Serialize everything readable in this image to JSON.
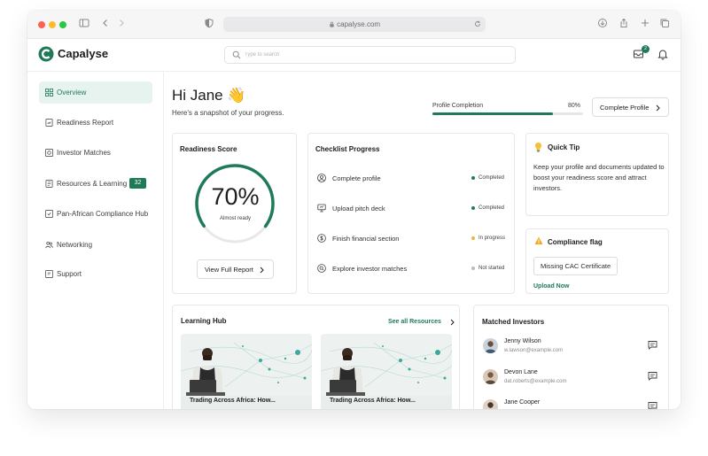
{
  "browser": {
    "url": "capalyse.com",
    "dot_colors": [
      "#fe5f57",
      "#febc2e",
      "#28c840"
    ]
  },
  "header": {
    "logo_text": "Capalyse",
    "search_placeholder": "Type to search",
    "notification_count": "2",
    "brand_color": "#1e7a57"
  },
  "sidebar": {
    "items": [
      {
        "label": "Overview",
        "icon": "grid-icon",
        "active": true
      },
      {
        "label": "Readiness Report",
        "icon": "report-icon"
      },
      {
        "label": "Investor Matches",
        "icon": "match-icon"
      },
      {
        "label": "Resources & Learning",
        "icon": "book-icon",
        "badge": "32"
      },
      {
        "label": "Pan-African Compliance Hub",
        "icon": "compliance-icon"
      },
      {
        "label": "Networking",
        "icon": "people-icon"
      },
      {
        "label": "Support",
        "icon": "support-icon"
      }
    ]
  },
  "greeting": {
    "title": "Hi Jane 👋",
    "subtitle": "Here's a snapshot of your progress."
  },
  "profile_completion": {
    "label": "Profile Completion",
    "value": "80%",
    "fraction": 0.8,
    "button_label": "Complete Profile"
  },
  "readiness": {
    "title": "Readiness Score",
    "score": "70%",
    "fraction": 0.7,
    "caption": "Almost ready",
    "button_label": "View Full Report"
  },
  "checklist": {
    "title": "Checklist Progress",
    "items": [
      {
        "label": "Complete profile",
        "icon": "user-icon",
        "status": "Completed",
        "status_color": "#1e7a57"
      },
      {
        "label": "Upload pitch deck",
        "icon": "presentation-icon",
        "status": "Completed",
        "status_color": "#1e7a57"
      },
      {
        "label": "Finish financial section",
        "icon": "finance-icon",
        "status": "In progress",
        "status_color": "#f2b33d"
      },
      {
        "label": "Explore investor matches",
        "icon": "search-icon",
        "status": "Not started",
        "status_color": "#b9b9be"
      }
    ]
  },
  "quick_tip": {
    "title": "Quick Tip",
    "text": "Keep your profile and documents updated to boost your readiness score and attract investors."
  },
  "compliance": {
    "title": "Compliance flag",
    "flag": "Missing CAC Certificate",
    "action": "Upload Now"
  },
  "learning_hub": {
    "title": "Learning Hub",
    "see_all": "See all Resources",
    "items": [
      {
        "title": "Trading Across Africa: How..."
      },
      {
        "title": "Trading Across Africa: How..."
      }
    ]
  },
  "matched_investors": {
    "title": "Matched Investors",
    "items": [
      {
        "name": "Jenny Wilson",
        "email": "w.lawson@example.com"
      },
      {
        "name": "Devon Lane",
        "email": "dat.roberts@example.com"
      },
      {
        "name": "Jane Cooper",
        "email": ""
      }
    ]
  }
}
